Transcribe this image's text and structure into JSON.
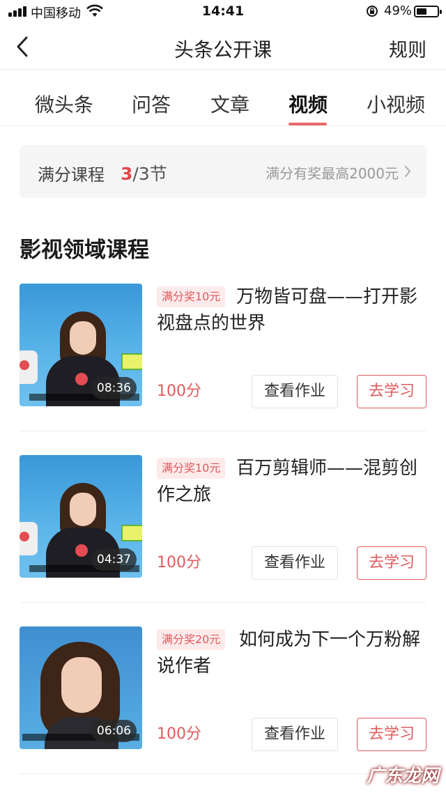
{
  "status_bar": {
    "carrier": "中国移动",
    "time": "14:41",
    "battery": "49%"
  },
  "nav": {
    "title": "头条公开课",
    "rules": "规则"
  },
  "tabs": [
    {
      "label": "微头条",
      "active": false
    },
    {
      "label": "问答",
      "active": false
    },
    {
      "label": "文章",
      "active": false
    },
    {
      "label": "视频",
      "active": true
    },
    {
      "label": "小视频",
      "active": false
    }
  ],
  "progress": {
    "label": "满分课程",
    "completed": "3",
    "total_suffix": "/3节",
    "reward": "满分有奖最高2000元"
  },
  "section_title": "影视领域课程",
  "courses": [
    {
      "badge": "满分奖10元",
      "title": "万物皆可盘——打开影视盘点的世界",
      "duration": "08:36",
      "score": "100分",
      "homework_label": "查看作业",
      "study_label": "去学习"
    },
    {
      "badge": "满分奖10元",
      "title": "百万剪辑师——混剪创作之旅",
      "duration": "04:37",
      "score": "100分",
      "homework_label": "查看作业",
      "study_label": "去学习"
    },
    {
      "badge": "满分奖20元",
      "title": "如何成为下一个万粉解说作者",
      "duration": "06:06",
      "score": "100分",
      "homework_label": "查看作业",
      "study_label": "去学习"
    }
  ],
  "watermark": "广东龙网",
  "colors": {
    "accent": "#e25a5c",
    "badge_bg": "#fdebec",
    "banner_bg": "#f5f5f5"
  }
}
